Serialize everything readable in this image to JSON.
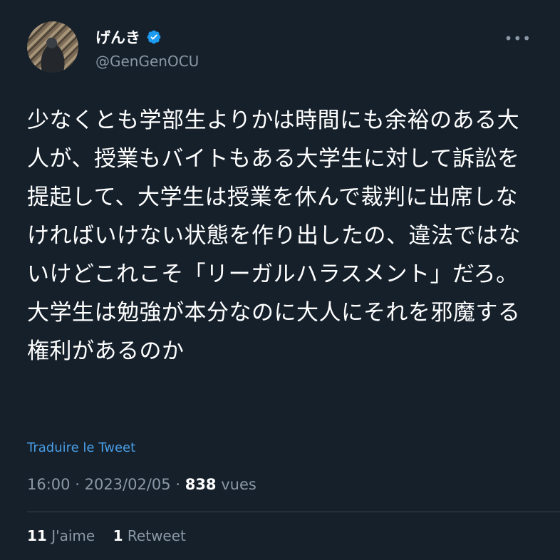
{
  "user": {
    "display_name": "げんき",
    "handle": "@GenGenOCU",
    "verified_icon": "verified-badge-icon",
    "more_icon": "more-dots-icon",
    "more_glyph": "•••"
  },
  "tweet": {
    "text": "少なくとも学部生よりかは時間にも余裕のある大人が、授業もバイトもある大学生に対して訴訟を提起して、大学生は授業を休んで裁判に出席しなければいけない状態を作り出したの、違法ではないけどこれこそ「リーガルハラスメント」だろ。\n大学生は勉強が本分なのに大人にそれを邪魔する権利があるのか",
    "translate_label": "Traduire le Tweet",
    "time": "16:00",
    "date": "2023/02/05",
    "separator": "·",
    "views_count": "838",
    "views_label": "vues"
  },
  "stats": {
    "likes_count": "11",
    "likes_label": "J'aime",
    "retweets_count": "1",
    "retweets_label": "Retweet"
  },
  "colors": {
    "background": "#15202b",
    "text": "#ffffff",
    "secondary": "#8b98a5",
    "link": "#4a9ee6",
    "verified": "#1d9bf0"
  }
}
